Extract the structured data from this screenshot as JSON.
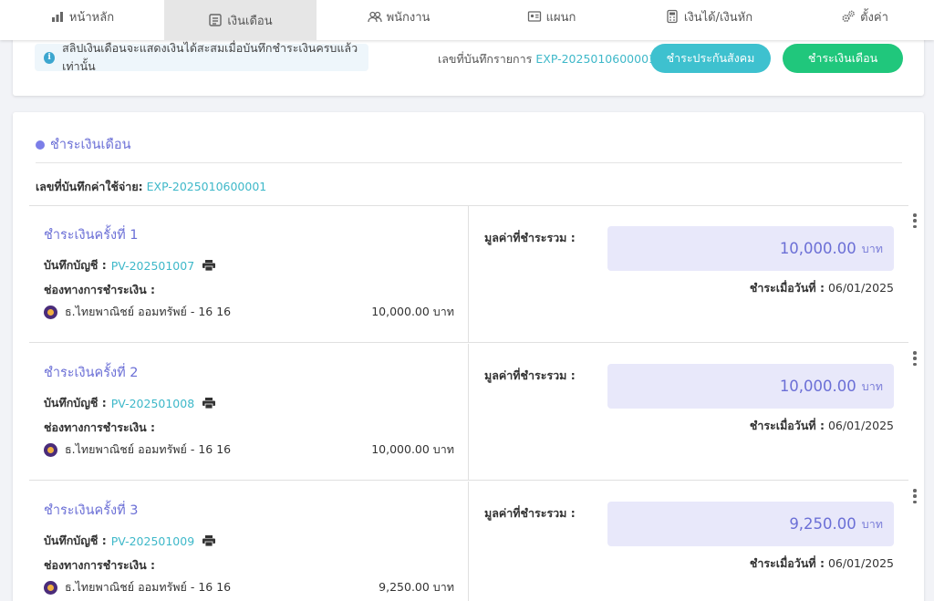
{
  "nav": {
    "tabs": [
      {
        "label": "หน้าหลัก",
        "icon": "bar-chart-icon"
      },
      {
        "label": "เงินเดือน",
        "icon": "payroll-icon",
        "active": true
      },
      {
        "label": "พนักงาน",
        "icon": "users-icon"
      },
      {
        "label": "แผนก",
        "icon": "id-card-icon"
      },
      {
        "label": "เงินได้/เงินหัก",
        "icon": "calculator-icon"
      },
      {
        "label": "ตั้งค่า",
        "icon": "gears-icon"
      }
    ]
  },
  "info": {
    "message": "สลิปเงินเดือนจะแสดงเงินได้สะสมเมื่อบันทึกชำระเงินครบแล้วเท่านั้น",
    "doc_label": "เลขที่บันทึกรายการ",
    "doc_number": "EXP-2025010600001",
    "btn_social": "ชำระประกันสังคม",
    "btn_salary": "ชำระเงินเดือน"
  },
  "main": {
    "title": "ชำระเงินเดือน",
    "exp_label": "เลขที่บันทึกค่าใช้จ่าย:",
    "exp_number": "EXP-2025010600001"
  },
  "payments": [
    {
      "title": "ชำระเงินครั้งที่ 1",
      "voucher_label": "บันทึกบัญชี :",
      "voucher": "PV-202501007",
      "channel_label": "ช่องทางการชำระเงิน :",
      "bank": "ธ.ไทยพาณิชย์ ออมทรัพย์ - 16 16",
      "bank_amount": "10,000.00 บาท",
      "total_label": "มูลค่าที่ชำระรวม :",
      "total": "10,000.00",
      "currency": "บาท",
      "date_label": "ชำระเมื่อวันที่ :",
      "date": "06/01/2025"
    },
    {
      "title": "ชำระเงินครั้งที่ 2",
      "voucher_label": "บันทึกบัญชี :",
      "voucher": "PV-202501008",
      "channel_label": "ช่องทางการชำระเงิน :",
      "bank": "ธ.ไทยพาณิชย์ ออมทรัพย์ - 16 16",
      "bank_amount": "10,000.00 บาท",
      "total_label": "มูลค่าที่ชำระรวม :",
      "total": "10,000.00",
      "currency": "บาท",
      "date_label": "ชำระเมื่อวันที่ :",
      "date": "06/01/2025"
    },
    {
      "title": "ชำระเงินครั้งที่ 3",
      "voucher_label": "บันทึกบัญชี :",
      "voucher": "PV-202501009",
      "channel_label": "ช่องทางการชำระเงิน :",
      "bank": "ธ.ไทยพาณิชย์ ออมทรัพย์ - 16 16",
      "bank_amount": "9,250.00 บาท",
      "total_label": "มูลค่าที่ชำระรวม :",
      "total": "9,250.00",
      "currency": "บาท",
      "date_label": "ชำระเมื่อวันที่ :",
      "date": "06/01/2025"
    }
  ],
  "colors": {
    "accent": "#6b6fd6",
    "link": "#3eb8c9",
    "btn_social": "#3ec1cf",
    "btn_salary": "#20c77c"
  }
}
